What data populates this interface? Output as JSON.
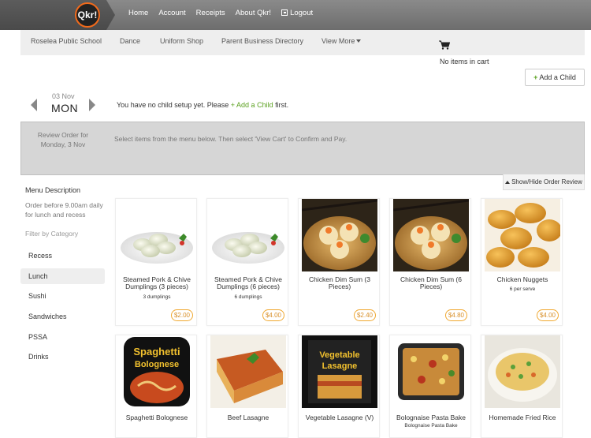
{
  "app": {
    "logo_text": "Qkr!"
  },
  "topnav": [
    "Home",
    "Account",
    "Receipts",
    "About Qkr!"
  ],
  "logout_label": "Logout",
  "subnav": [
    "Roselea Public School",
    "Dance",
    "Uniform Shop",
    "Parent Business Directory",
    "View More"
  ],
  "cart": {
    "status": "No items in cart",
    "icon": "cart-icon"
  },
  "add_child_label": "Add a Child",
  "date": {
    "small": "03 Nov",
    "day": "MON"
  },
  "no_child": {
    "before": "You have no child setup yet. Please ",
    "link": "Add a Child",
    "after": " first."
  },
  "review": {
    "label_line1": "Review Order for",
    "label_line2": "Monday, 3 Nov",
    "instructions": "Select items from the menu below. Then select 'View Cart' to Confirm and Pay.",
    "toggle_label": "Show/Hide Order Review"
  },
  "sidebar": {
    "title": "Menu Description",
    "note": "Order before 9.00am daily for lunch and recess",
    "filter_label": "Filter by Category",
    "categories": [
      "Recess",
      "Lunch",
      "Sushi",
      "Sandwiches",
      "PSSA",
      "Drinks"
    ],
    "active_category": "Lunch"
  },
  "menu_items": [
    {
      "name": "Steamed Pork & Chive Dumplings (3 pieces)",
      "sub": "3 dumplings",
      "price": "$2.00",
      "image": "dumplings"
    },
    {
      "name": "Steamed Pork & Chive Dumplings (6 pieces)",
      "sub": "6 dumplings",
      "price": "$4.00",
      "image": "dumplings"
    },
    {
      "name": "Chicken Dim Sum (3 Pieces)",
      "sub": "",
      "price": "$2.40",
      "image": "dimsum"
    },
    {
      "name": "Chicken Dim Sum (6 Pieces)",
      "sub": "",
      "price": "$4.80",
      "image": "dimsum"
    },
    {
      "name": "Chicken Nuggets",
      "sub": "6 per serve",
      "price": "$4.00",
      "image": "nuggets"
    },
    {
      "name": "Spaghetti Bolognese",
      "sub": "",
      "price": "",
      "image": "tray-spaghetti",
      "pack_text": "Spaghetti Bolognese"
    },
    {
      "name": "Beef Lasagne",
      "sub": "",
      "price": "",
      "image": "lasagne"
    },
    {
      "name": "Vegetable Lasagne (V)",
      "sub": "",
      "price": "",
      "image": "tray-vegetable",
      "pack_text": "Vegetable Lasagne"
    },
    {
      "name": "Bolognaise Pasta Bake",
      "sub": "Bolognaise Pasta Bake",
      "price": "",
      "image": "pastabake"
    },
    {
      "name": "Homemade Fried Rice",
      "sub": "",
      "price": "",
      "image": "friedrice"
    }
  ],
  "colors": {
    "accent_green": "#5aa01e",
    "price_orange": "#f0a830",
    "topbar": "#7a7a7a"
  }
}
